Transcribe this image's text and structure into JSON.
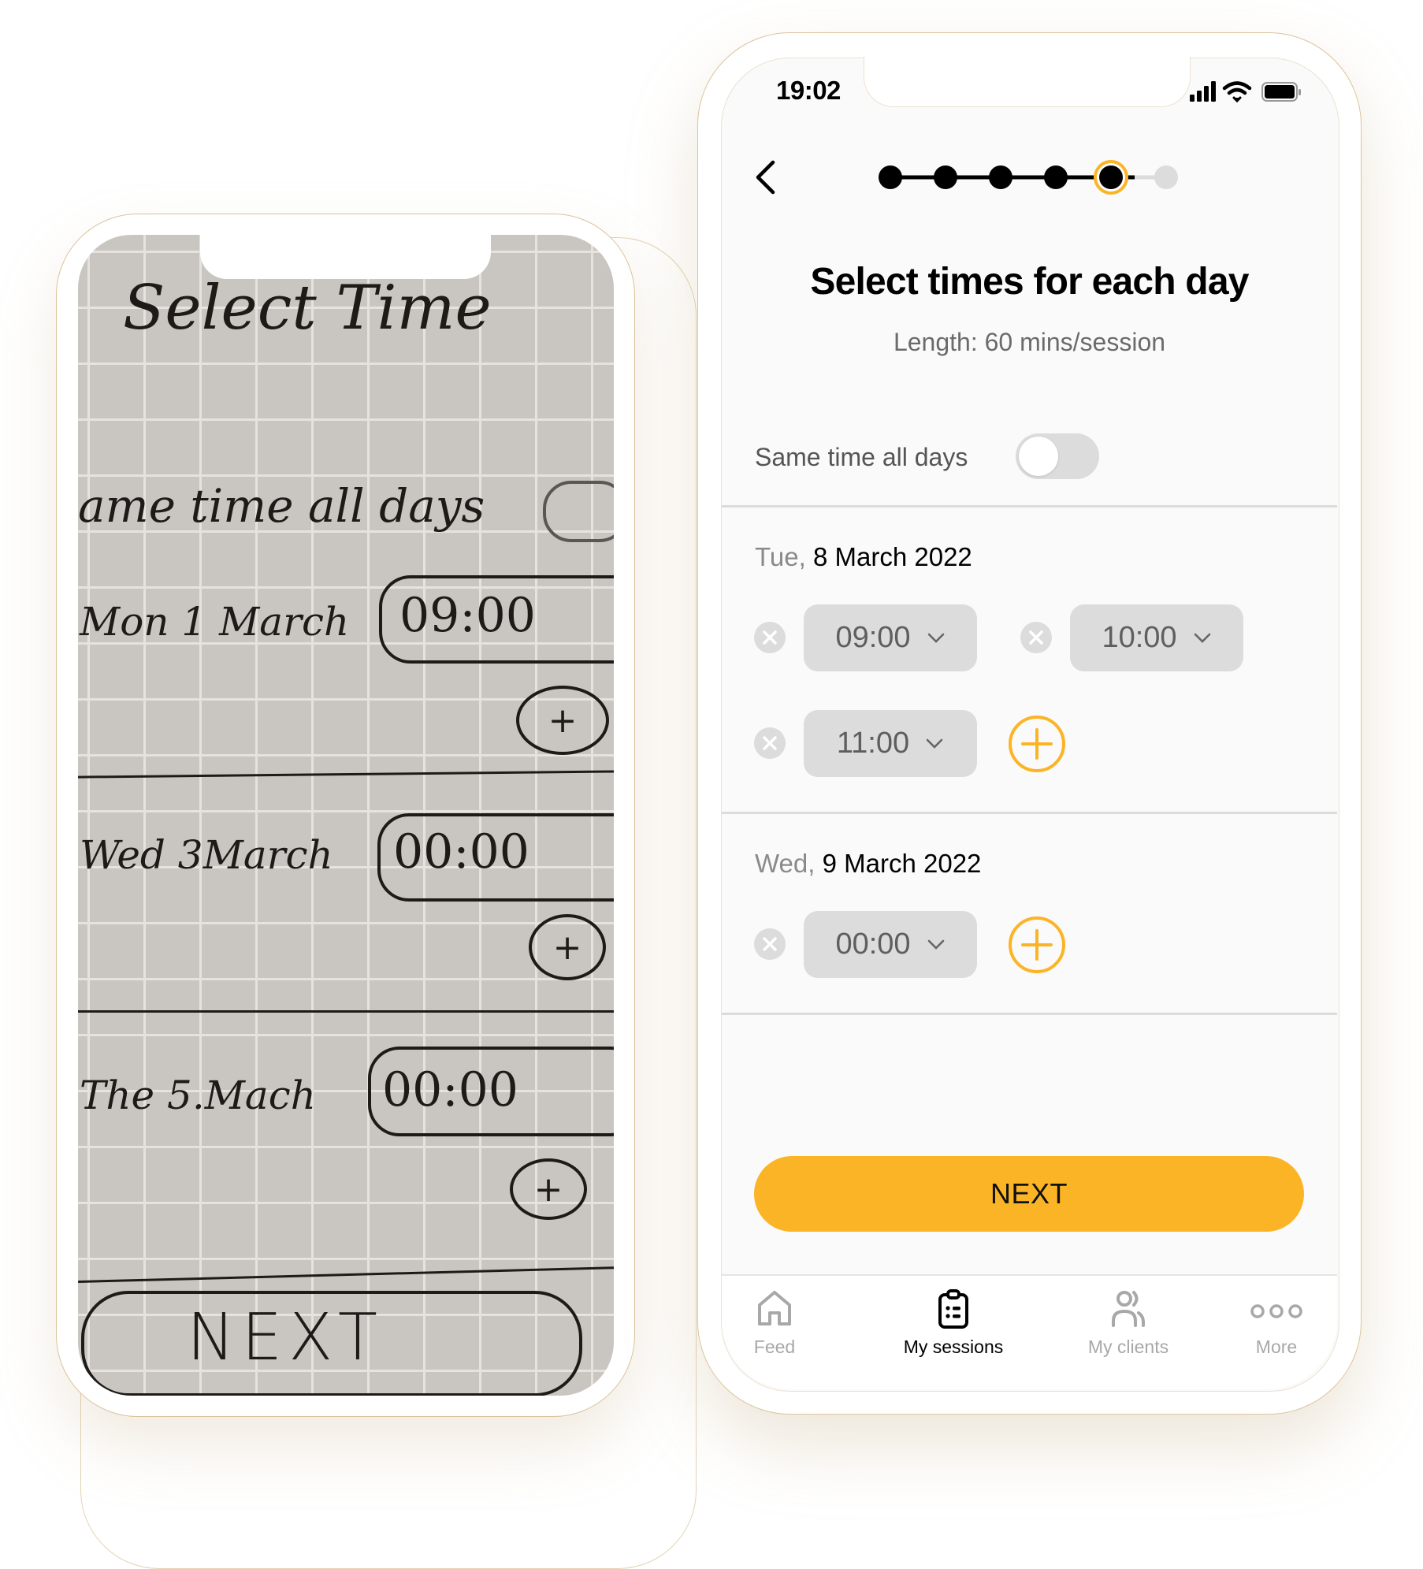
{
  "sketch": {
    "title": "Select Time",
    "same_time_label": "ame time all days",
    "days": [
      {
        "label": "Mon 1 March",
        "time": "09:00"
      },
      {
        "label": "Wed 3March",
        "time": "00:00"
      },
      {
        "label": "The 5.Mach",
        "time": "00:00"
      }
    ],
    "chevron": "v",
    "plus": "+",
    "next_label": "NEXT"
  },
  "status_bar": {
    "time": "19:02",
    "icons": [
      "signal-icon",
      "wifi-icon",
      "battery-icon"
    ]
  },
  "progress": {
    "total_steps": 6,
    "current_step": 5
  },
  "header": {
    "title": "Select times for each day",
    "subtitle": "Length: 60 mins/session"
  },
  "same_time": {
    "label": "Same time all days",
    "enabled": false
  },
  "days": [
    {
      "weekday": "Tue,",
      "date": "8 March 2022",
      "times": [
        "09:00",
        "10:00",
        "11:00"
      ]
    },
    {
      "weekday": "Wed,",
      "date": "9 March 2022",
      "times": [
        "00:00"
      ]
    }
  ],
  "next_button": {
    "label": "NEXT"
  },
  "tabbar": {
    "items": [
      {
        "label": "Feed",
        "icon": "home-icon",
        "active": false
      },
      {
        "label": "My sessions",
        "icon": "clipboard-icon",
        "active": true
      },
      {
        "label": "My clients",
        "icon": "users-icon",
        "active": false
      },
      {
        "label": "More",
        "icon": "more-dots-icon",
        "active": false
      }
    ]
  },
  "colors": {
    "accent": "#fcb427",
    "pill_bg": "#dcdcdc",
    "text_muted": "#8a8a8a",
    "screen_bg": "#fafafa"
  }
}
